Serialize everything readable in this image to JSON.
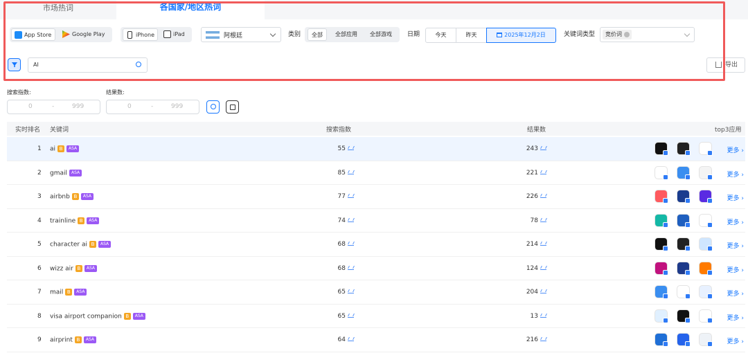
{
  "tabs": {
    "market": "市场热词",
    "country": "各国家/地区热词"
  },
  "filters": {
    "store": {
      "app_store": "App Store",
      "google_play": "Google Play"
    },
    "device": {
      "iphone": "iPhone",
      "ipad": "iPad"
    },
    "country": "阿根廷",
    "category_label": "类别",
    "category": {
      "all": "全部",
      "all_apps": "全部应用",
      "all_games": "全部游戏"
    },
    "date_label": "日期",
    "date": {
      "today": "今天",
      "yesterday": "昨天",
      "selected": "2025年12月2日"
    },
    "kw_type_label": "关键词类型",
    "kw_type_tag": "竞价词",
    "search_value": "AI",
    "export": "导出"
  },
  "ranges": {
    "search_index_label": "搜索指数:",
    "results_label": "结果数:",
    "min": "0",
    "dash": "-",
    "max": "999"
  },
  "table": {
    "headers": {
      "rank": "实时排名",
      "keyword": "关键词",
      "search_index": "搜索指数",
      "results": "结果数",
      "top3": "top3应用"
    },
    "more": "更多 ›",
    "rows": [
      {
        "rank": "1",
        "keyword": "ai",
        "b": true,
        "asa": "ASA",
        "index": "55",
        "results": "243",
        "apps": [
          "#111",
          "#222",
          "#fff"
        ]
      },
      {
        "rank": "2",
        "keyword": "gmail",
        "b": false,
        "asa": "ASA",
        "index": "85",
        "results": "221",
        "apps": [
          "#fff",
          "#3a8ef0",
          "#f4f4f4"
        ]
      },
      {
        "rank": "3",
        "keyword": "airbnb",
        "b": true,
        "asa": "ASA",
        "index": "77",
        "results": "226",
        "apps": [
          "#ff5a5f",
          "#1a3c8e",
          "#5a2be2"
        ]
      },
      {
        "rank": "4",
        "keyword": "trainline",
        "b": true,
        "asa": "ASA",
        "index": "74",
        "results": "78",
        "apps": [
          "#14b8a6",
          "#1f5fbf",
          "#fff"
        ]
      },
      {
        "rank": "5",
        "keyword": "character ai",
        "b": true,
        "asa": "ASA",
        "index": "68",
        "results": "214",
        "apps": [
          "#111",
          "#222",
          "#cfe6ff"
        ]
      },
      {
        "rank": "6",
        "keyword": "wizz air",
        "b": true,
        "asa": "ASA",
        "index": "68",
        "results": "124",
        "apps": [
          "#c1127e",
          "#1e3a8a",
          "#ff7a00"
        ]
      },
      {
        "rank": "7",
        "keyword": "mail",
        "b": true,
        "asa": "ASA",
        "index": "65",
        "results": "204",
        "apps": [
          "#3a8ef0",
          "#fff",
          "#e8f1ff"
        ]
      },
      {
        "rank": "8",
        "keyword": "visa airport companion",
        "b": true,
        "asa": "ASA",
        "index": "65",
        "results": "13",
        "apps": [
          "#e0f0ff",
          "#111",
          "#fff"
        ]
      },
      {
        "rank": "9",
        "keyword": "airprint",
        "b": true,
        "asa": "ASA",
        "index": "64",
        "results": "216",
        "apps": [
          "#1f6fd6",
          "#2563eb",
          "#eef2f7"
        ]
      }
    ]
  },
  "colors": {
    "accent": "#1677ff",
    "highlight_box": "#f05a5a",
    "badge_b": "#f5a623",
    "badge_asa": "#9b59f5"
  }
}
